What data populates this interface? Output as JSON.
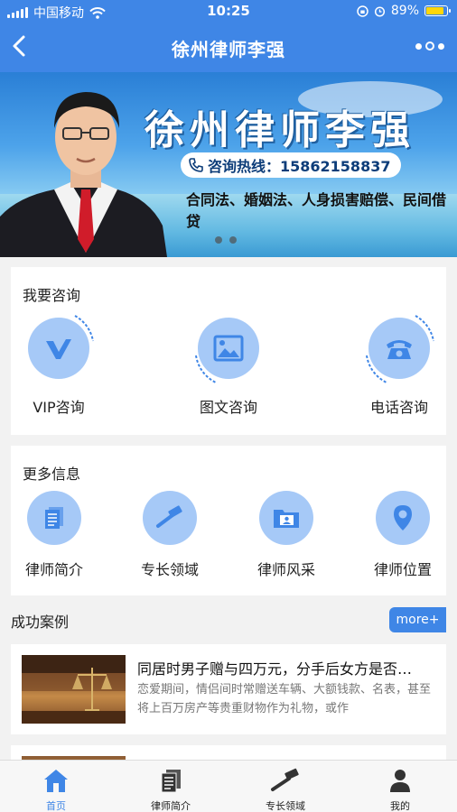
{
  "status": {
    "carrier": "中国移动",
    "time": "10:25",
    "battery": "89%"
  },
  "nav": {
    "title": "徐州律师李强"
  },
  "banner": {
    "title": "徐州律师李强",
    "hotline": "咨询热线：15862158837",
    "areas": "合同法、婚姻法、人身损害赔偿、民间借贷"
  },
  "consult": {
    "title": "我要咨询",
    "items": [
      {
        "label": "VIP咨询",
        "icon": "vip-icon"
      },
      {
        "label": "图文咨询",
        "icon": "image-icon"
      },
      {
        "label": "电话咨询",
        "icon": "phone-icon"
      }
    ]
  },
  "more_info": {
    "title": "更多信息",
    "items": [
      {
        "label": "律师简介",
        "icon": "document-icon"
      },
      {
        "label": "专长领域",
        "icon": "gavel-icon"
      },
      {
        "label": "律师风采",
        "icon": "folder-profile-icon"
      },
      {
        "label": "律师位置",
        "icon": "location-pin-icon"
      }
    ]
  },
  "cases": {
    "title": "成功案例",
    "more": "more+",
    "items": [
      {
        "title": "同居时男子赠与四万元，分手后女方是否…",
        "desc": "恋爱期间，情侣间时常赠送车辆、大额钱款、名表，甚至将上百万房产等贵重财物作为礼物，或作"
      }
    ]
  },
  "tabs": [
    {
      "label": "首页",
      "icon": "home-icon"
    },
    {
      "label": "律师简介",
      "icon": "document-icon"
    },
    {
      "label": "专长领域",
      "icon": "gavel-icon"
    },
    {
      "label": "我的",
      "icon": "user-icon"
    }
  ],
  "colors": {
    "primary": "#3f86e6",
    "icon_disc": "#a6c9f7",
    "icon_fg": "#3f86e6"
  }
}
